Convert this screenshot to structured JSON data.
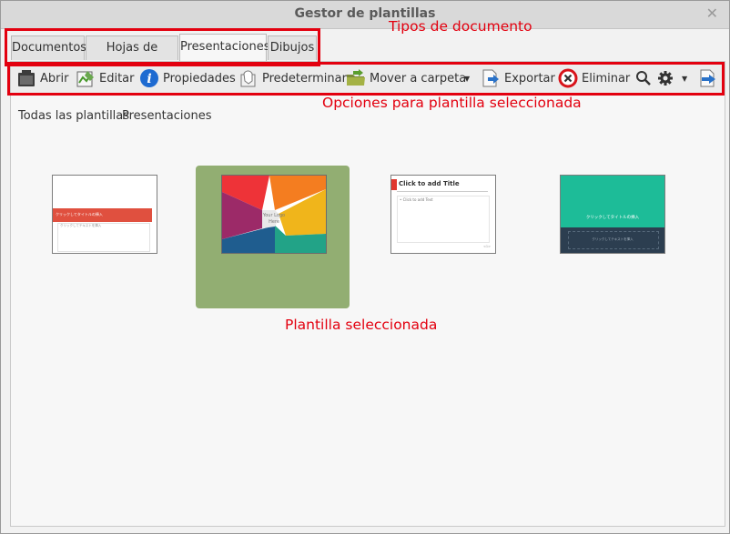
{
  "window": {
    "title": "Gestor de plantillas"
  },
  "tabs": [
    {
      "label": "Documentos"
    },
    {
      "label": "Hojas de cálculo"
    },
    {
      "label": "Presentaciones"
    },
    {
      "label": "Dibujos"
    }
  ],
  "toolbar": {
    "open": "Abrir",
    "edit": "Editar",
    "properties": "Propiedades",
    "default": "Predeterminar",
    "move": "Mover a carpeta",
    "export": "Exportar",
    "delete": "Eliminar"
  },
  "breadcrumb": {
    "root": "Todas las plantillas",
    "current": "Presentaciones"
  },
  "annotations": {
    "doc_types": "Tipos de documento",
    "options": "Opciones para plantilla seleccionada",
    "selected": "Plantilla seleccionada"
  },
  "templates": [
    {
      "title": "クリックしてタイトルの挿入",
      "subtitle": "クリックしてテキストを挿入",
      "accent": "#e0503f"
    },
    {
      "logo": "Your Logo Here",
      "colors": [
        "#ee3338",
        "#f47d20",
        "#f0b51b",
        "#22a387",
        "#1f5d8f",
        "#9c2a68"
      ]
    },
    {
      "title": "Click to add Title",
      "body": "• Click to add Text",
      "page": "<1>",
      "accent": "#e0372f"
    },
    {
      "title": "クリックしてタイトルの挿入",
      "subtitle": "クリックしてテキストを挿入",
      "top": "#1dbc98",
      "bottom": "#2c3e50"
    }
  ]
}
